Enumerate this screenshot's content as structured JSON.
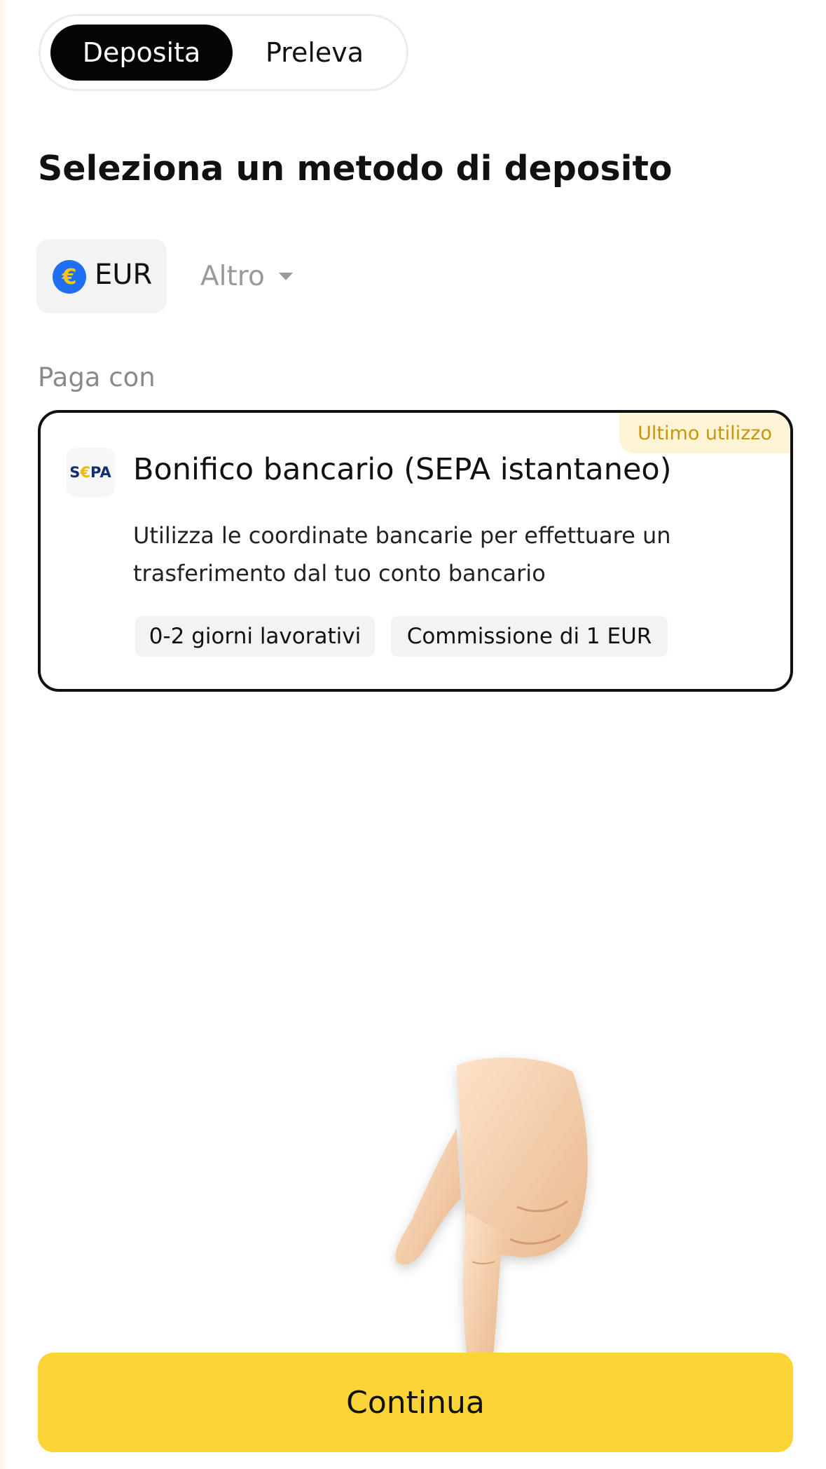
{
  "tabs": {
    "deposit_label": "Deposita",
    "withdraw_label": "Preleva",
    "active": "Deposita"
  },
  "page_title": "Seleziona un metodo di deposito",
  "currency": {
    "selected_code": "EUR",
    "icon": "euro-icon",
    "other_label": "Altro"
  },
  "pay_with_label": "Paga con",
  "method": {
    "logo_text": "SEPA",
    "title": "Bonifico bancario (SEPA istantaneo)",
    "description": "Utilizza le coordinate bancarie per effettuare un trasferimento dal tuo conto bancario",
    "badge": "Ultimo utilizzo",
    "tags": [
      "0-2 giorni lavorativi",
      "Commissione di 1 EUR"
    ]
  },
  "illustration": "pointing-hand-down",
  "continue_label": "Continua",
  "colors": {
    "accent_yellow": "#fbd535",
    "active_tab": "#050505",
    "badge_text": "#c8960e",
    "euro_icon_bg": "#1f6ff2"
  }
}
